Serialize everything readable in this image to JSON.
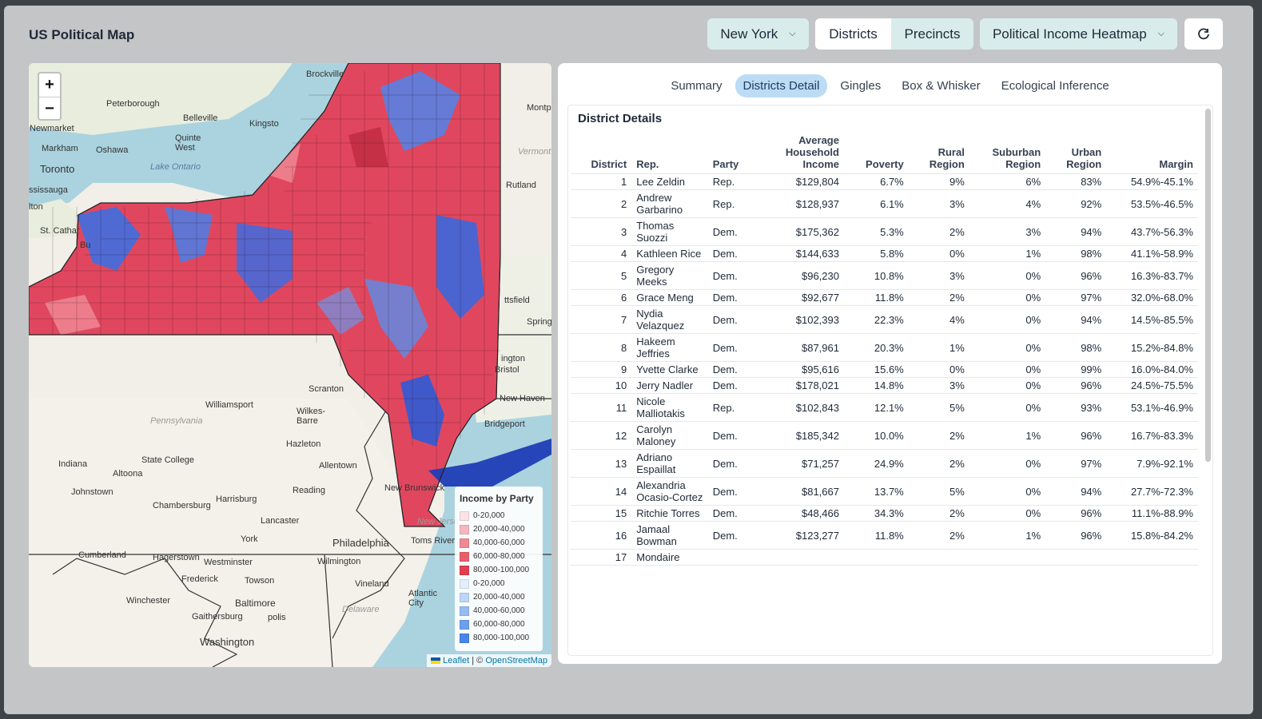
{
  "app_title": "US Political Map",
  "toolbar": {
    "state_dropdown": "New York",
    "seg_districts": "Districts",
    "seg_precincts": "Precincts",
    "view_dropdown": "Political Income Heatmap"
  },
  "map": {
    "zoom_in": "+",
    "zoom_out": "−",
    "labels": {
      "brockville": "Brockville",
      "peterborough": "Peterborough",
      "belleville": "Belleville",
      "kingston": "Kingsto",
      "quinte_west": "Quinte\nWest",
      "newmarket": "Newmarket",
      "markham": "Markham",
      "oshawa": "Oshawa",
      "toronto": "Toronto",
      "lake_ontario": "Lake Ontario",
      "mississauga": "ssissauga",
      "burlington": "lton",
      "st_catharines": "St. Cathar",
      "bu": "Bu",
      "montpelier": "Montp",
      "vermont": "Vermont",
      "rutland": "Rutland",
      "pittsfield": "ttsfield",
      "spring": "Spring",
      "ington": "ington",
      "bristol": "Bristol",
      "new_haven": "New Haven",
      "bridgeport": "Bridgeport",
      "scranton": "Scranton",
      "williamsport": "Williamsport",
      "wilkes_barre": "Wilkes-\nBarre",
      "pennsylvania": "Pennsylvania",
      "hazleton": "Hazleton",
      "state_college": "State College",
      "indiana": "Indiana",
      "altoona": "Altoona",
      "allentown": "Allentown",
      "new_brunswick": "New Brunswick",
      "johnstown": "Johnstown",
      "reading": "Reading",
      "harrisburg": "Harrisburg",
      "chambersburg": "Chambersburg",
      "lancaster": "Lancaster",
      "york": "York",
      "new_jersey": "New Jersey",
      "toms_river": "Toms River",
      "philadelphia": "Philadelphia",
      "cumberland": "Cumberland",
      "hagerstown": "Hagerstown",
      "westminster": "Westminster",
      "wilmington": "Wilmington",
      "vineland": "Vineland",
      "frederick": "Frederick",
      "towson": "Towson",
      "atlantic_city": "Atlantic\nCity",
      "winchester": "Winchester",
      "gaithersburg": "Gaithersburg",
      "baltimore": "Baltimore",
      "delaware": "Delaware",
      "annapolis": "polis",
      "washington": "Washington"
    },
    "legend": {
      "title": "Income by Party",
      "rows": [
        {
          "label": "0-20,000",
          "color": "#fbe3e6"
        },
        {
          "label": "20,000-40,000",
          "color": "#f6b6bd"
        },
        {
          "label": "40,000-60,000",
          "color": "#f08892"
        },
        {
          "label": "60,000-80,000",
          "color": "#ea5e6b"
        },
        {
          "label": "80,000-100,000",
          "color": "#e33e4f"
        },
        {
          "label": "0-20,000",
          "color": "#e4eefc"
        },
        {
          "label": "20,000-40,000",
          "color": "#bcd5f8"
        },
        {
          "label": "40,000-60,000",
          "color": "#95bbf3"
        },
        {
          "label": "60,000-80,000",
          "color": "#6d9fef"
        },
        {
          "label": "80,000-100,000",
          "color": "#4a84ea"
        }
      ]
    },
    "attribution": {
      "leaflet": "Leaflet",
      "sep": " | © ",
      "osm": "OpenStreetMap"
    }
  },
  "panel": {
    "tabs": [
      "Summary",
      "Districts Detail",
      "Gingles",
      "Box & Whisker",
      "Ecological Inference"
    ],
    "active_tab": "Districts Detail",
    "table_title": "District Details",
    "columns": [
      "District",
      "Rep.",
      "Party",
      "Average Household Income",
      "Poverty",
      "Rural Region",
      "Suburban Region",
      "Urban Region",
      "Margin"
    ],
    "rows": [
      [
        "1",
        "Lee Zeldin",
        "Rep.",
        "$129,804",
        "6.7%",
        "9%",
        "6%",
        "83%",
        "54.9%-45.1%"
      ],
      [
        "2",
        "Andrew Garbarino",
        "Rep.",
        "$128,937",
        "6.1%",
        "3%",
        "4%",
        "92%",
        "53.5%-46.5%"
      ],
      [
        "3",
        "Thomas Suozzi",
        "Dem.",
        "$175,362",
        "5.3%",
        "2%",
        "3%",
        "94%",
        "43.7%-56.3%"
      ],
      [
        "4",
        "Kathleen Rice",
        "Dem.",
        "$144,633",
        "5.8%",
        "0%",
        "1%",
        "98%",
        "41.1%-58.9%"
      ],
      [
        "5",
        "Gregory Meeks",
        "Dem.",
        "$96,230",
        "10.8%",
        "3%",
        "0%",
        "96%",
        "16.3%-83.7%"
      ],
      [
        "6",
        "Grace Meng",
        "Dem.",
        "$92,677",
        "11.8%",
        "2%",
        "0%",
        "97%",
        "32.0%-68.0%"
      ],
      [
        "7",
        "Nydia Velazquez",
        "Dem.",
        "$102,393",
        "22.3%",
        "4%",
        "0%",
        "94%",
        "14.5%-85.5%"
      ],
      [
        "8",
        "Hakeem Jeffries",
        "Dem.",
        "$87,961",
        "20.3%",
        "1%",
        "0%",
        "98%",
        "15.2%-84.8%"
      ],
      [
        "9",
        "Yvette Clarke",
        "Dem.",
        "$95,616",
        "15.6%",
        "0%",
        "0%",
        "99%",
        "16.0%-84.0%"
      ],
      [
        "10",
        "Jerry Nadler",
        "Dem.",
        "$178,021",
        "14.8%",
        "3%",
        "0%",
        "96%",
        "24.5%-75.5%"
      ],
      [
        "11",
        "Nicole Malliotakis",
        "Rep.",
        "$102,843",
        "12.1%",
        "5%",
        "0%",
        "93%",
        "53.1%-46.9%"
      ],
      [
        "12",
        "Carolyn Maloney",
        "Dem.",
        "$185,342",
        "10.0%",
        "2%",
        "1%",
        "96%",
        "16.7%-83.3%"
      ],
      [
        "13",
        "Adriano Espaillat",
        "Dem.",
        "$71,257",
        "24.9%",
        "2%",
        "0%",
        "97%",
        "7.9%-92.1%"
      ],
      [
        "14",
        "Alexandria Ocasio-Cortez",
        "Dem.",
        "$81,667",
        "13.7%",
        "5%",
        "0%",
        "94%",
        "27.7%-72.3%"
      ],
      [
        "15",
        "Ritchie Torres",
        "Dem.",
        "$48,466",
        "34.3%",
        "2%",
        "0%",
        "96%",
        "11.1%-88.9%"
      ],
      [
        "16",
        "Jamaal Bowman",
        "Dem.",
        "$123,277",
        "11.8%",
        "2%",
        "1%",
        "96%",
        "15.8%-84.2%"
      ],
      [
        "17",
        "Mondaire",
        "",
        "",
        "",
        "",
        "",
        "",
        ""
      ]
    ]
  }
}
